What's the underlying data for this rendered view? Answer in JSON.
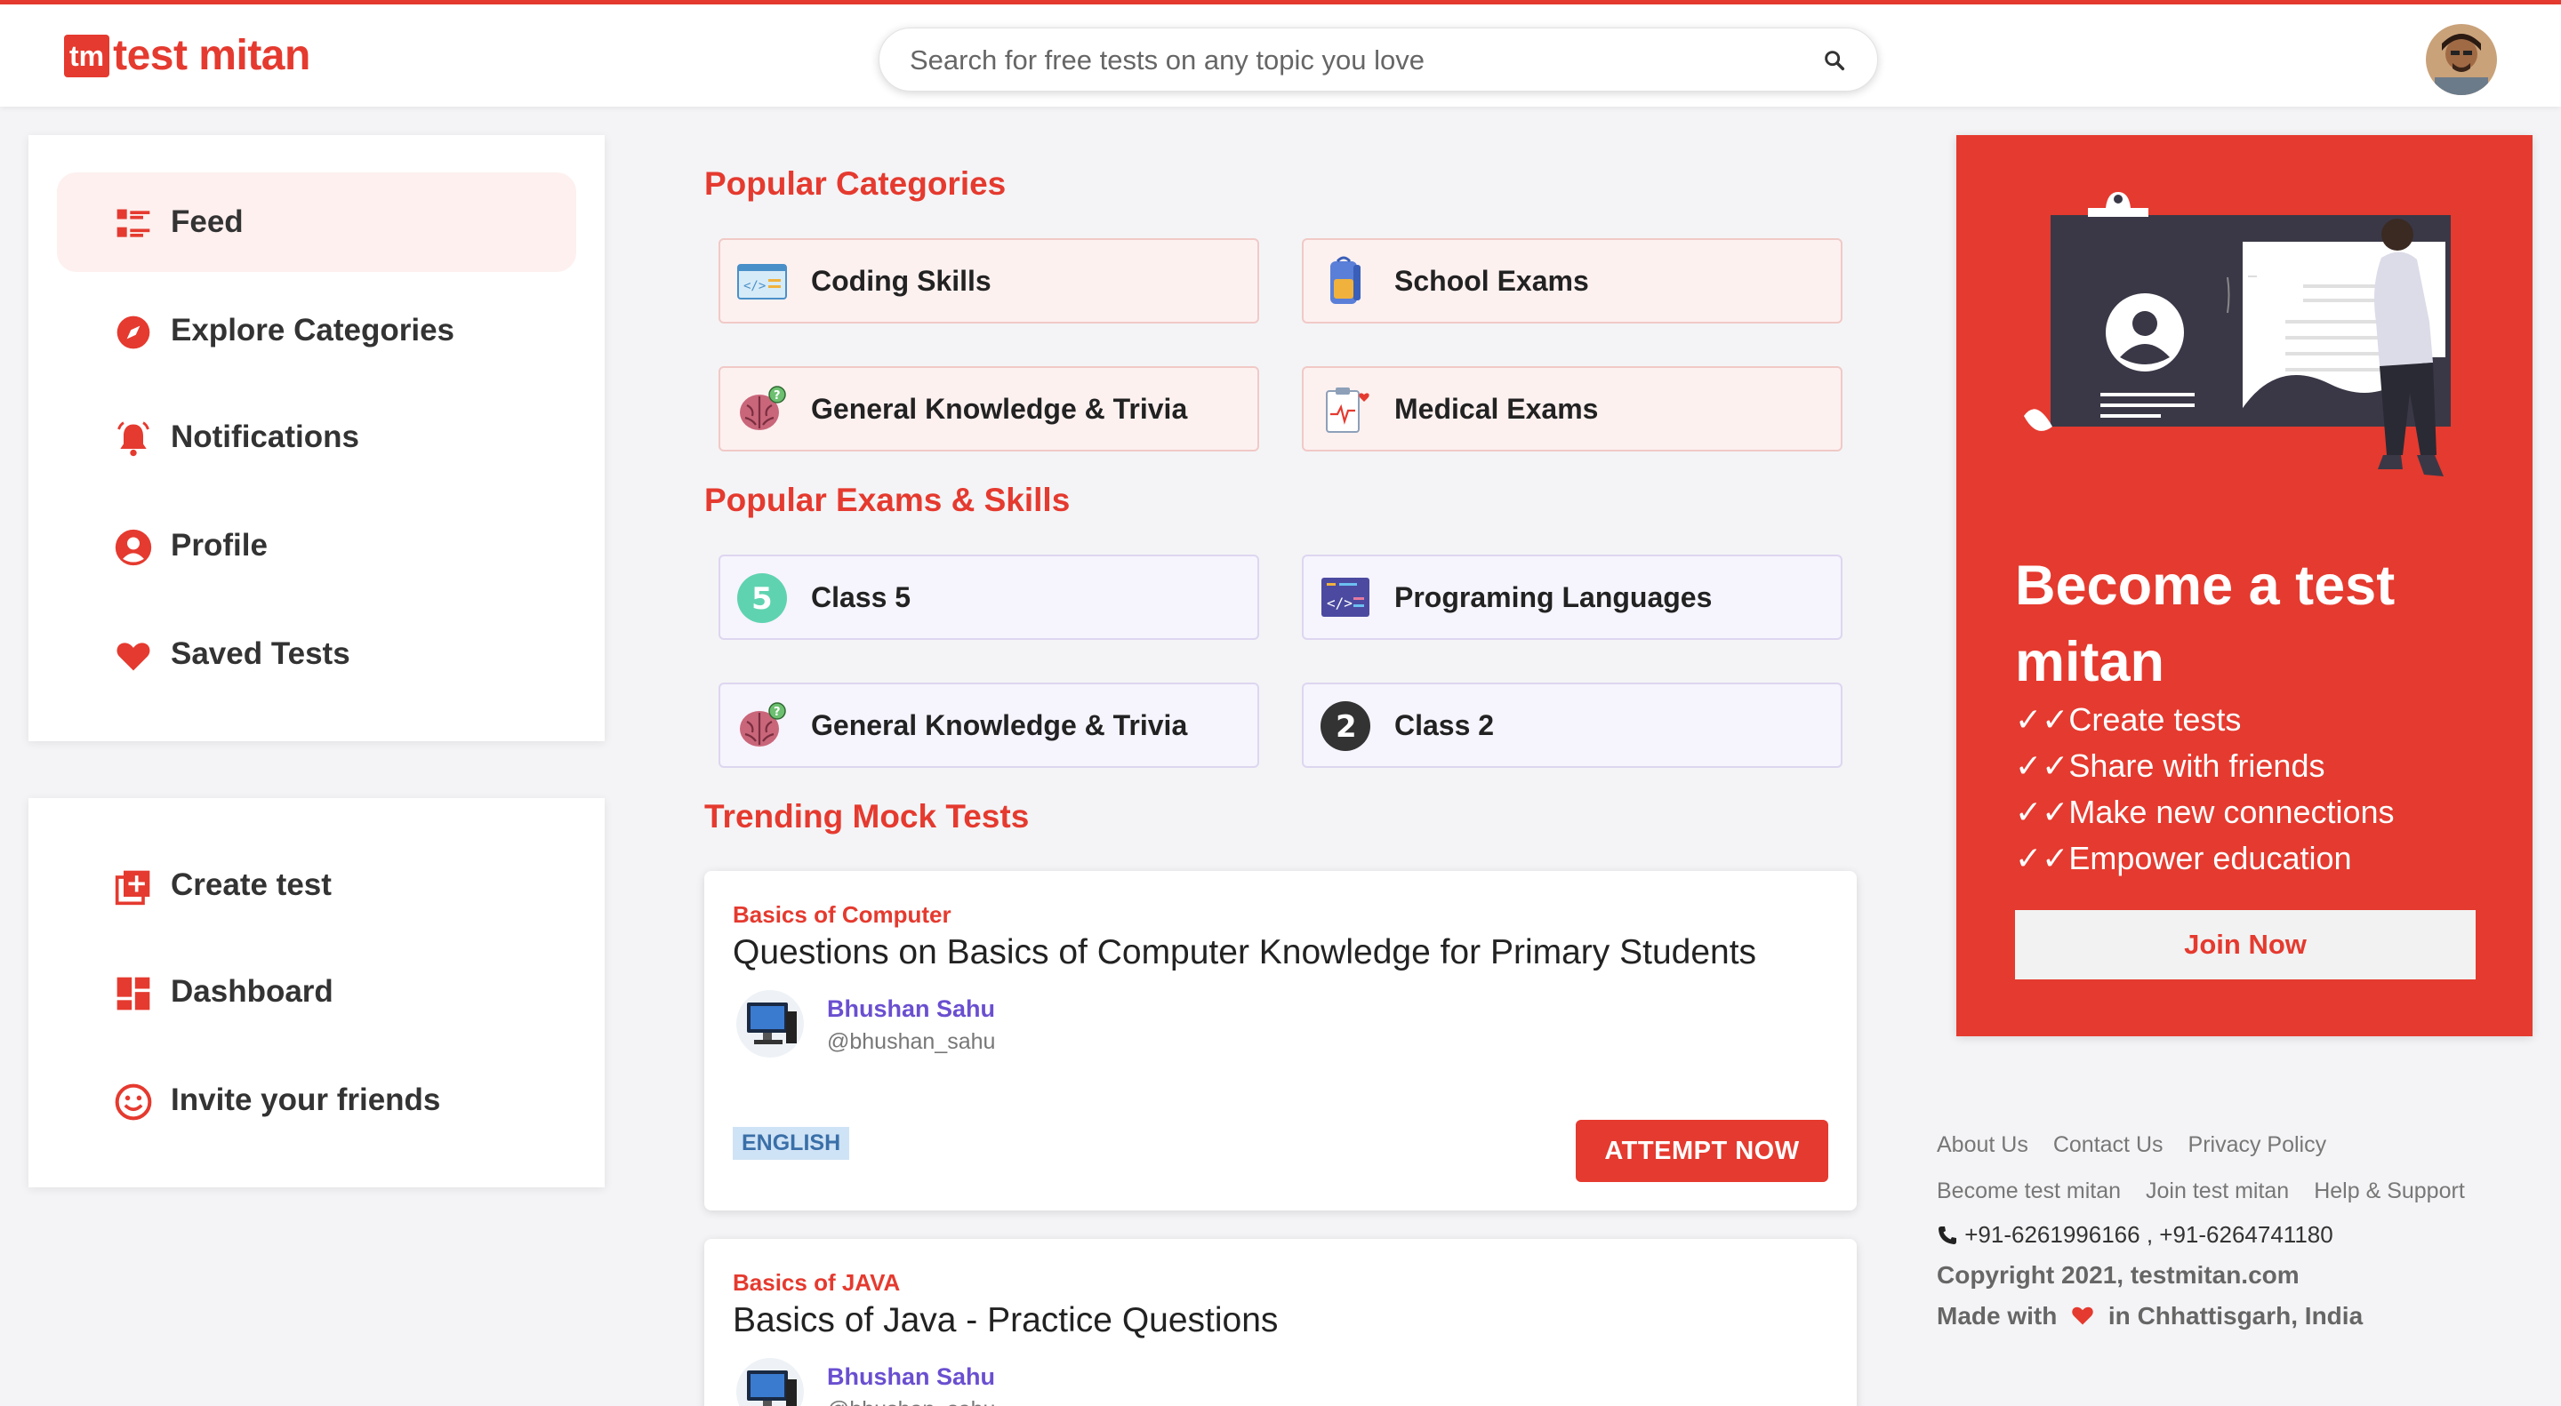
{
  "header": {
    "logo_badge": "tm",
    "logo_text": "test mitan",
    "search_placeholder": "Search for free tests on any topic you love"
  },
  "nav_primary": [
    {
      "label": "Feed",
      "icon": "feed-icon",
      "active": true
    },
    {
      "label": "Explore Categories",
      "icon": "compass-icon"
    },
    {
      "label": "Notifications",
      "icon": "bell-icon"
    },
    {
      "label": "Profile",
      "icon": "user-icon"
    },
    {
      "label": "Saved Tests",
      "icon": "heart-icon"
    }
  ],
  "nav_secondary": [
    {
      "label": "Create test",
      "icon": "add-box-icon"
    },
    {
      "label": "Dashboard",
      "icon": "dashboard-icon"
    },
    {
      "label": "Invite your friends",
      "icon": "smiley-icon"
    }
  ],
  "sections": {
    "categories_title": "Popular Categories",
    "exams_title": "Popular Exams & Skills",
    "trending_title": "Trending Mock Tests"
  },
  "categories": [
    {
      "label": "Coding Skills",
      "icon": "code-window-icon"
    },
    {
      "label": "School Exams",
      "icon": "backpack-icon"
    },
    {
      "label": "General Knowledge & Trivia",
      "icon": "brain-icon"
    },
    {
      "label": "Medical Exams",
      "icon": "medical-clipboard-icon"
    }
  ],
  "exams": [
    {
      "label": "Class 5",
      "icon": "number-5-icon"
    },
    {
      "label": "Programing Languages",
      "icon": "code-screen-icon"
    },
    {
      "label": "General Knowledge & Trivia",
      "icon": "brain-icon"
    },
    {
      "label": "Class 2",
      "icon": "number-2-icon"
    }
  ],
  "tests": [
    {
      "category": "Basics of Computer",
      "title": "Questions on Basics of Computer Knowledge for Primary Students",
      "author": "Bhushan Sahu",
      "handle": "@bhushan_sahu",
      "language": "ENGLISH",
      "button": "ATTEMPT NOW"
    },
    {
      "category": "Basics of JAVA",
      "title": "Basics of Java - Practice Questions",
      "author": "Bhushan Sahu",
      "handle": "@bhushan_sahu"
    }
  ],
  "promo": {
    "heading": "Become a test mitan",
    "items": [
      "Create tests",
      "Share with friends",
      "Make new connections",
      "Empower education"
    ],
    "check": "✓✓",
    "button": "Join Now"
  },
  "footer": {
    "links_row1": [
      "About Us",
      "Contact Us",
      "Privacy Policy"
    ],
    "links_row2": [
      "Become test mitan",
      "Join test mitan",
      "Help & Support"
    ],
    "phone": "+91-6261996166 , +91-6264741180",
    "copyright": "Copyright 2021, testmitan.com",
    "made_with_prefix": "Made with",
    "made_with_suffix": "in Chhattisgarh, India"
  },
  "colors": {
    "brand": "#e53a2f",
    "author": "#6a4fd0"
  }
}
